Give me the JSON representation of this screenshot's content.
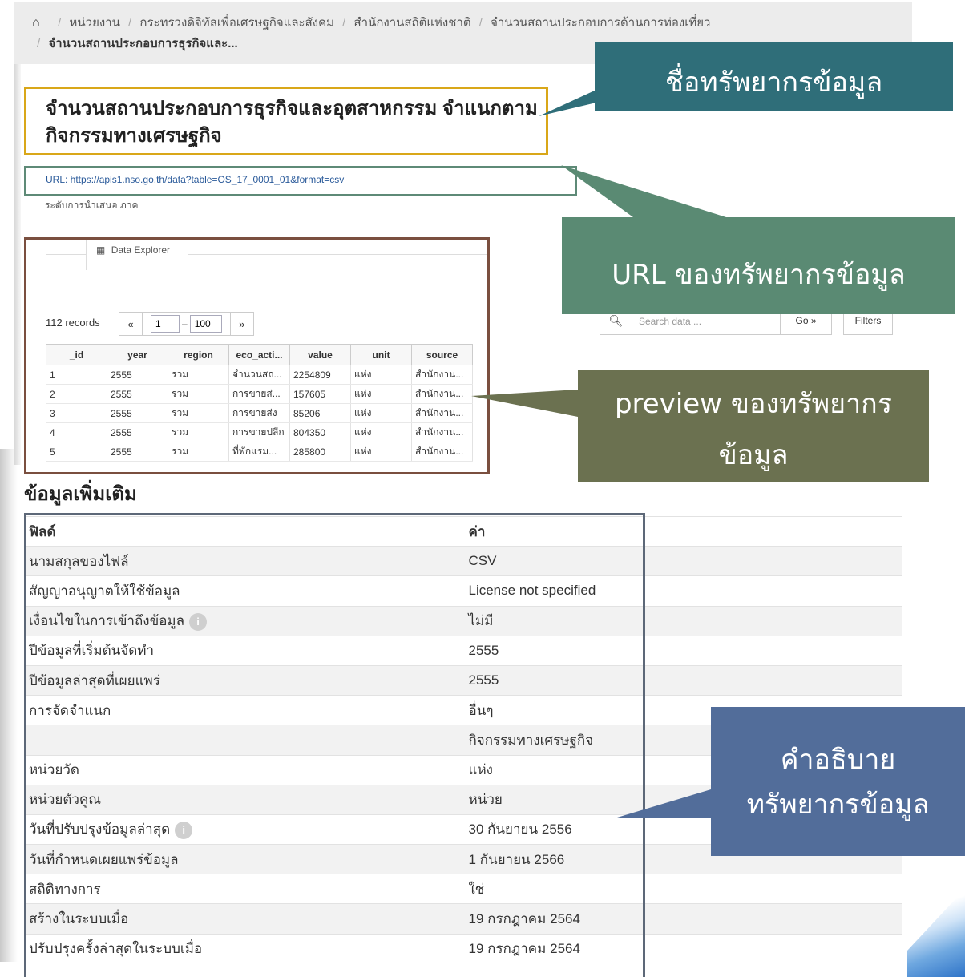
{
  "breadcrumb": {
    "items": [
      "หน่วยงาน",
      "กระทรวงดิจิทัลเพื่อเศรษฐกิจและสังคม",
      "สำนักงานสถิติแห่งชาติ",
      "จำนวนสถานประกอบการด้านการท่องเที่ยว"
    ],
    "current": "จำนวนสถานประกอบการธุรกิจและ..."
  },
  "dataset": {
    "title_line1": "จำนวนสถานประกอบการธุรกิจและอุตสาหกรรม จำแนกตาม",
    "title_line2": "กิจกรรมทางเศรษฐกิจ",
    "url_text": "URL: https://apis1.nso.go.th/data?table=OS_17_0001_01&format=csv",
    "level_text": "ระดับการนำเสนอ ภาค"
  },
  "explorer": {
    "tab_label": "Data Explorer",
    "records": "112 records",
    "pager": {
      "prev": "«",
      "from": "1",
      "dash": "–",
      "to": "100",
      "next": "»"
    },
    "columns": [
      "_id",
      "year",
      "region",
      "eco_acti...",
      "value",
      "unit",
      "source"
    ],
    "rows": [
      [
        "1",
        "2555",
        "รวม",
        "จำนวนสถ...",
        "2254809",
        "แห่ง",
        "สำนักงาน..."
      ],
      [
        "2",
        "2555",
        "รวม",
        "การขายส่...",
        "157605",
        "แห่ง",
        "สำนักงาน..."
      ],
      [
        "3",
        "2555",
        "รวม",
        "การขายส่ง",
        "85206",
        "แห่ง",
        "สำนักงาน..."
      ],
      [
        "4",
        "2555",
        "รวม",
        "การขายปลีก",
        "804350",
        "แห่ง",
        "สำนักงาน..."
      ],
      [
        "5",
        "2555",
        "รวม",
        "ที่พักแรม...",
        "285800",
        "แห่ง",
        "สำนักงาน..."
      ]
    ]
  },
  "search": {
    "placeholder": "Search data ...",
    "go_label": "Go »",
    "filters_label": "Filters"
  },
  "additional": {
    "heading": "ข้อมูลเพิ่มเติม",
    "rows": [
      {
        "key": "ฟิลด์",
        "value": "ค่า"
      },
      {
        "key": "นามสกุลของไฟล์",
        "value": "CSV"
      },
      {
        "key": "สัญญาอนุญาตให้ใช้ข้อมูล",
        "value": "License not specified"
      },
      {
        "key": "เงื่อนไขในการเข้าถึงข้อมูล",
        "value": "ไม่มี",
        "info": true
      },
      {
        "key": "ปีข้อมูลที่เริ่มต้นจัดทำ",
        "value": "2555"
      },
      {
        "key": "ปีข้อมูลล่าสุดที่เผยแพร่",
        "value": "2555"
      },
      {
        "key": "การจัดจำแนก",
        "value": "อื่นๆ"
      },
      {
        "key": "",
        "value": "กิจกรรมทางเศรษฐกิจ"
      },
      {
        "key": "หน่วยวัด",
        "value": "แห่ง"
      },
      {
        "key": "หน่วยตัวคูณ",
        "value": "หน่วย"
      },
      {
        "key": "วันที่ปรับปรุงข้อมูลล่าสุด",
        "value": "30 กันยายน 2556",
        "info": true
      },
      {
        "key": "วันที่กำหนดเผยแพร่ข้อมูล",
        "value": "1 กันยายน 2566"
      },
      {
        "key": "สถิติทางการ",
        "value": "ใช่"
      },
      {
        "key": "สร้างในระบบเมื่อ",
        "value": "19 กรกฎาคม 2564"
      },
      {
        "key": "ปรับปรุงครั้งล่าสุดในระบบเมื่อ",
        "value": "19 กรกฎาคม 2564"
      }
    ]
  },
  "callouts": {
    "name": "ชื่อทรัพยากรข้อมูล",
    "url": "URL ของทรัพยากรข้อมูล",
    "preview_line1": "preview ของทรัพยากร",
    "preview_line2": "ข้อมูล",
    "desc_line1": "คำอธิบาย",
    "desc_line2": "ทรัพยากรข้อมูล"
  },
  "colors": {
    "title_frame": "#d9a719",
    "url_frame": "#5e8a77",
    "explorer_frame": "#7a4f3f",
    "info_frame": "#5d6878",
    "callout_name": "#2f6e79",
    "callout_url": "#5a8a73",
    "callout_preview": "#6b7150",
    "callout_desc": "#526d9a"
  },
  "icons": {
    "home": "home-icon",
    "grid": "table-grid-icon",
    "search": "search-icon",
    "info": "info-icon"
  }
}
